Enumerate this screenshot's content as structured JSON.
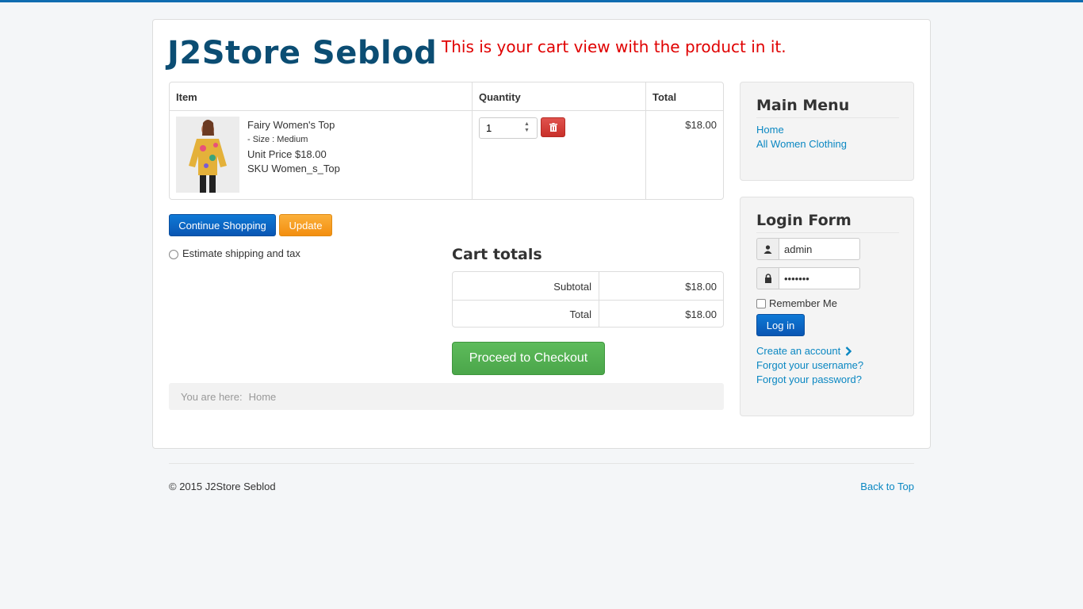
{
  "site": {
    "title": "J2Store Seblod"
  },
  "annotation": "This is your cart view with the product in it.",
  "cart": {
    "headers": {
      "item": "Item",
      "quantity": "Quantity",
      "total": "Total"
    },
    "item": {
      "name": "Fairy Women's Top",
      "size": "- Size : Medium",
      "unit_price": "Unit Price $18.00",
      "sku": "SKU Women_s_Top",
      "quantity": "1",
      "total": "$18.00"
    },
    "continue_label": "Continue Shopping",
    "update_label": "Update",
    "estimate_label": "Estimate shipping and tax"
  },
  "totals": {
    "title": "Cart totals",
    "subtotal_label": "Subtotal",
    "subtotal_value": "$18.00",
    "total_label": "Total",
    "total_value": "$18.00",
    "checkout_label": "Proceed to Checkout"
  },
  "breadcrumb": {
    "prefix": "You are here:",
    "item": "Home"
  },
  "main_menu": {
    "title": "Main Menu",
    "items": [
      "Home",
      "All Women Clothing"
    ]
  },
  "login": {
    "title": "Login Form",
    "username": "admin",
    "password": "•••••••",
    "remember": "Remember Me",
    "button": "Log in",
    "create_account": "Create an account",
    "forgot_username": "Forgot your username?",
    "forgot_password": "Forgot your password?"
  },
  "footer": {
    "copyright": "© 2015 J2Store Seblod",
    "back_to_top": "Back to Top"
  },
  "colors": {
    "brand": "#0b4d73",
    "link": "#0a87c2",
    "danger": "#c8302a",
    "success": "#4ba64a",
    "warning": "#f38e0f"
  }
}
